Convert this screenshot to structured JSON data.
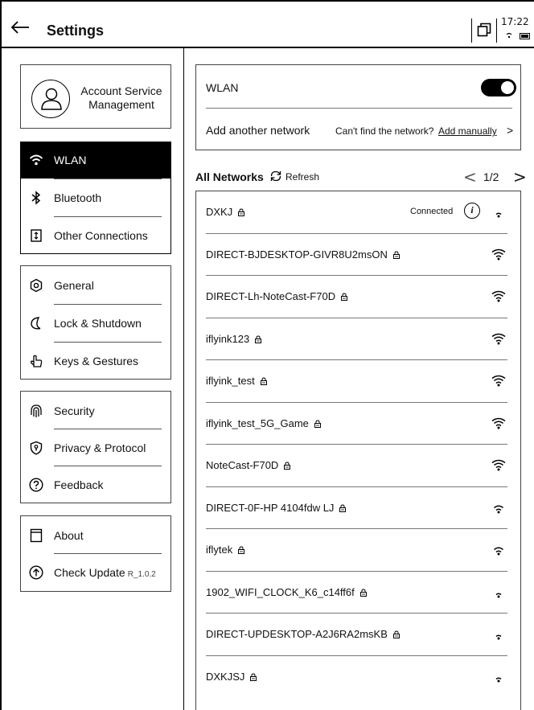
{
  "header": {
    "title": "Settings",
    "time": "17:22"
  },
  "account": {
    "label": "Account Service Management"
  },
  "menu_groups": [
    [
      {
        "label": "WLAN",
        "icon": "wifi-icon",
        "active": true
      },
      {
        "label": "Bluetooth",
        "icon": "bluetooth-icon"
      },
      {
        "label": "Other Connections",
        "icon": "connections-icon"
      }
    ],
    [
      {
        "label": "General",
        "icon": "general-icon"
      },
      {
        "label": "Lock & Shutdown",
        "icon": "moon-icon"
      },
      {
        "label": "Keys & Gestures",
        "icon": "hand-icon"
      }
    ],
    [
      {
        "label": "Security",
        "icon": "fingerprint-icon"
      },
      {
        "label": "Privacy & Protocol",
        "icon": "shield-icon"
      },
      {
        "label": "Feedback",
        "icon": "question-icon"
      }
    ],
    [
      {
        "label": "About",
        "icon": "about-icon"
      },
      {
        "label": "Check Update",
        "icon": "upload-icon",
        "version": "R_1.0.2"
      }
    ]
  ],
  "wlan": {
    "label": "WLAN",
    "enabled": true,
    "add_network": "Add another network",
    "hint": "Can't find the network?",
    "add_manually": "Add manually",
    "chevron": ">"
  },
  "networks_header": {
    "title": "All Networks",
    "refresh": "Refresh",
    "page": "1/2",
    "prev": "<",
    "next": ">"
  },
  "networks": [
    {
      "name": "DXKJ",
      "locked": true,
      "status": "Connected",
      "info": "i",
      "signal": 1
    },
    {
      "name": "DIRECT-BJDESKTOP-GIVR8U2msON",
      "locked": true,
      "signal": 3
    },
    {
      "name": "DIRECT-Lh-NoteCast-F70D",
      "locked": true,
      "signal": 3
    },
    {
      "name": "iflyink123",
      "locked": true,
      "signal": 3
    },
    {
      "name": "iflyink_test",
      "locked": true,
      "signal": 3
    },
    {
      "name": "iflyink_test_5G_Game",
      "locked": true,
      "signal": 3
    },
    {
      "name": "NoteCast-F70D",
      "locked": true,
      "signal": 3
    },
    {
      "name": "DIRECT-0F-HP 4104fdw LJ",
      "locked": true,
      "signal": 2
    },
    {
      "name": "iflytek",
      "locked": true,
      "signal": 2
    },
    {
      "name": "1902_WIFI_CLOCK_K6_c14ff6f",
      "locked": true,
      "signal": 1
    },
    {
      "name": "DIRECT-UPDESKTOP-A2J6RA2msKB",
      "locked": true,
      "signal": 1
    },
    {
      "name": "DXKJSJ",
      "locked": true,
      "signal": 1
    }
  ]
}
